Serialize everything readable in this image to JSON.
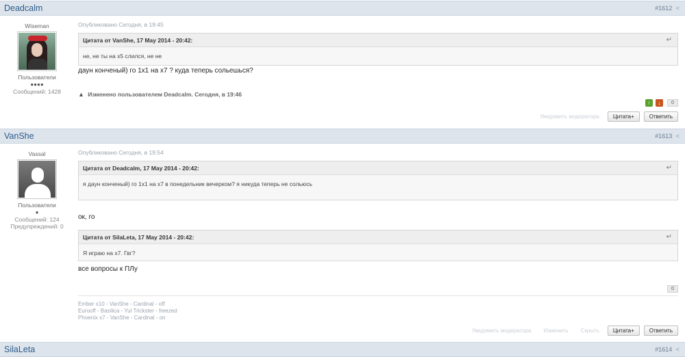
{
  "posts": [
    {
      "author": "Deadcalm",
      "post_id": "#1612",
      "user_title": "Wiseman",
      "group": "Пользователи",
      "dots": "●●●●",
      "stats": [
        "Сообщений: 1428"
      ],
      "meta": "Опубликовано Сегодня, в 19:45",
      "quotes": [
        {
          "head": "Цитата от VanShe, 17 May 2014 - 20:42:",
          "body": "не, не ты на x5 слился, не не"
        }
      ],
      "messages": [
        "даун конченый) го 1х1 на х7 ? куда теперь сольешься?"
      ],
      "edit_note": "Изменено пользователем Deadcalm. Сегодня, в 19:46",
      "rep_score": "0",
      "actions": {
        "report": "Уведомить модератора",
        "quote": "Цитата+",
        "reply": "Ответить"
      }
    },
    {
      "author": "VanShe",
      "post_id": "#1613",
      "user_title": "Vassal",
      "group": "Пользователи",
      "dots": "●",
      "stats": [
        "Сообщений: 124",
        "Предупреждений: 0"
      ],
      "meta": "Опубликовано Сегодня, в 19:54",
      "quotes": [
        {
          "head": "Цитата от Deadcalm, 17 May 2014 - 20:42:",
          "body": "я даун конченый) го 1х1 на х7 в понедельник вечерком? я никуда теперь не сольюсь"
        },
        {
          "head": "Цитата от SilaLeta, 17 May 2014 - 20:42:",
          "body": "Я играю на x7. Гвг?"
        }
      ],
      "messages": [
        "ок, го",
        "все вопросы к ПЛу"
      ],
      "rep_score": "0",
      "signature": [
        "Ember x10 - VanShe - Cardinal - off",
        "Eurooff - Basilica - Yul Trickster - freezed",
        "Phoenix x7 - VanShe - Cardinal - on"
      ],
      "actions": {
        "report": "Уведомить модератора",
        "edit": "Изменить",
        "hide": "Скрыть",
        "quote": "Цитата+",
        "reply": "Ответить"
      }
    },
    {
      "author": "SilaLeta",
      "post_id": "#1614"
    }
  ],
  "icons": {
    "share": "share-icon",
    "return": "return-arrow-icon",
    "warning": "warning-icon",
    "vote_up": "vote-up-icon",
    "vote_down": "vote-down-icon"
  },
  "colors": {
    "header_bg": "#dde4ec",
    "author_link": "#2c5c8a",
    "vote_up": "#5aa02c",
    "vote_down": "#c8541e"
  }
}
